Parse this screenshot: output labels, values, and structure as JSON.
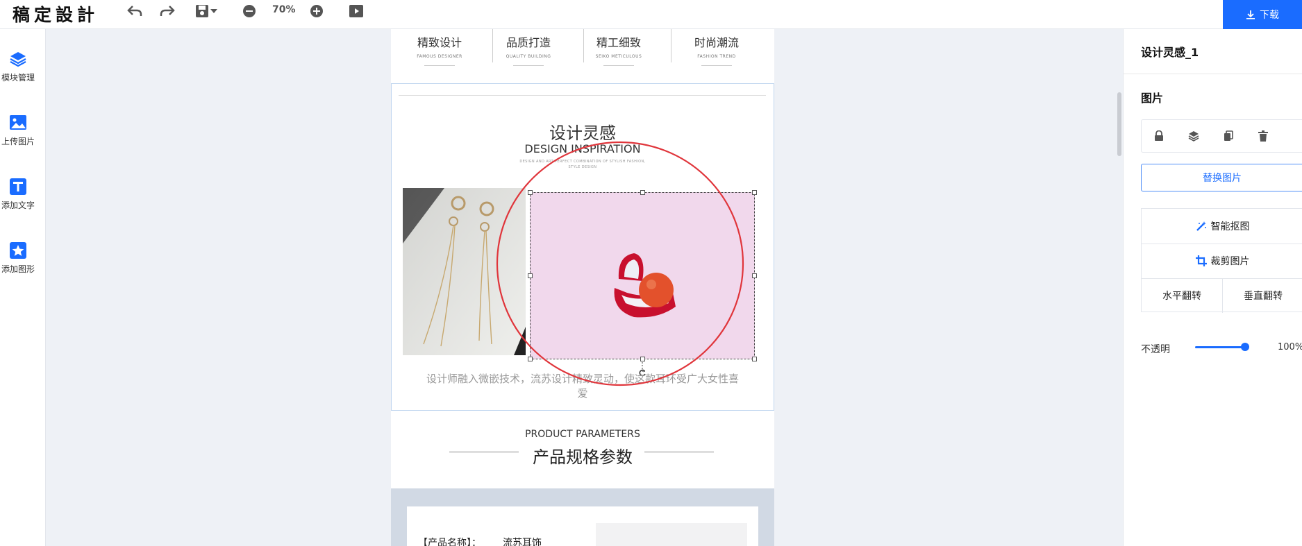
{
  "app": {
    "logo": "稿定設計",
    "zoom": "70%",
    "download_label": "下载"
  },
  "left_sidebar": {
    "items": [
      {
        "label": "模块管理",
        "icon": "layers-icon"
      },
      {
        "label": "上传图片",
        "icon": "image-icon"
      },
      {
        "label": "添加文字",
        "icon": "text-icon"
      },
      {
        "label": "添加图形",
        "icon": "shape-icon"
      }
    ]
  },
  "right_panel": {
    "title": "设计灵感_1",
    "section": "图片",
    "icons": [
      "lock-icon",
      "layers-icon",
      "copy-icon",
      "trash-icon"
    ],
    "replace_label": "替换图片",
    "smart_cutout_label": "智能抠图",
    "crop_label": "裁剪图片",
    "flip_h_label": "水平翻转",
    "flip_v_label": "垂直翻转",
    "opacity_label": "不透明",
    "opacity_value": "100%",
    "opacity_fraction": 1.0
  },
  "canvas": {
    "features": [
      {
        "title": "精致设计",
        "sub": "FAMOUS DESIGNER"
      },
      {
        "title": "品质打造",
        "sub": "QUALITY BUILDING"
      },
      {
        "title": "精工细致",
        "sub": "SEIKO METICULOUS"
      },
      {
        "title": "时尚潮流",
        "sub": "FASHION TREND"
      }
    ],
    "inspiration": {
      "title_cn": "设计灵感",
      "title_en": "DESIGN INSPIRATION",
      "small_1": "DESIGN AND ART PERFECT COMBINATION OF STYLISH FASHION,",
      "small_2": "STYLE DESIGN",
      "description": "设计师融入微嵌技术，流苏设计精致灵动，使这款耳环受广大女性喜爱"
    },
    "params": {
      "title_en": "PRODUCT PARAMETERS",
      "title_cn": "产品规格参数",
      "row_key": "【产品名称】：",
      "row_value": "流苏耳饰"
    }
  },
  "colors": {
    "accent": "#1a6cff",
    "annotation": "#e0353b",
    "photo_bg": "#f1d8ec"
  }
}
